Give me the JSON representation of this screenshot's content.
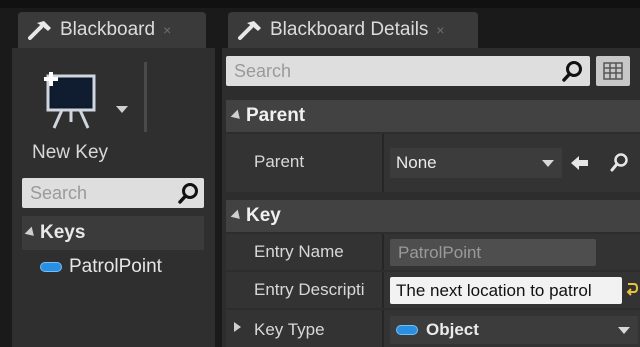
{
  "left_panel": {
    "tab_title": "Blackboard",
    "tab_close": "×",
    "new_key_label": "New Key",
    "search_placeholder": "Search",
    "keys_section_label": "Keys",
    "keys": [
      {
        "name": "PatrolPoint",
        "type_color": "#2a8fe0"
      }
    ]
  },
  "right_panel": {
    "tab_title": "Blackboard Details",
    "tab_close": "×",
    "search_placeholder": "Search",
    "sections": {
      "parent": {
        "title": "Parent",
        "rows": {
          "parent": {
            "label": "Parent",
            "value": "None"
          }
        }
      },
      "key": {
        "title": "Key",
        "rows": {
          "entry_name": {
            "label": "Entry Name",
            "value": "PatrolPoint"
          },
          "entry_description": {
            "label": "Entry Descripti",
            "value": "The next location to patrol"
          },
          "key_type": {
            "label": "Key Type",
            "value": "Object"
          }
        }
      }
    }
  },
  "colors": {
    "accent_blue": "#2a8fe0",
    "panel_bg": "#2f2f2f",
    "section_header_bg": "#424242",
    "reset_arrow": "#e8c33a"
  },
  "icons": [
    "hammer-icon",
    "new-key-icon",
    "search-icon",
    "view-options-icon",
    "arrow-left-icon",
    "reset-icon"
  ]
}
